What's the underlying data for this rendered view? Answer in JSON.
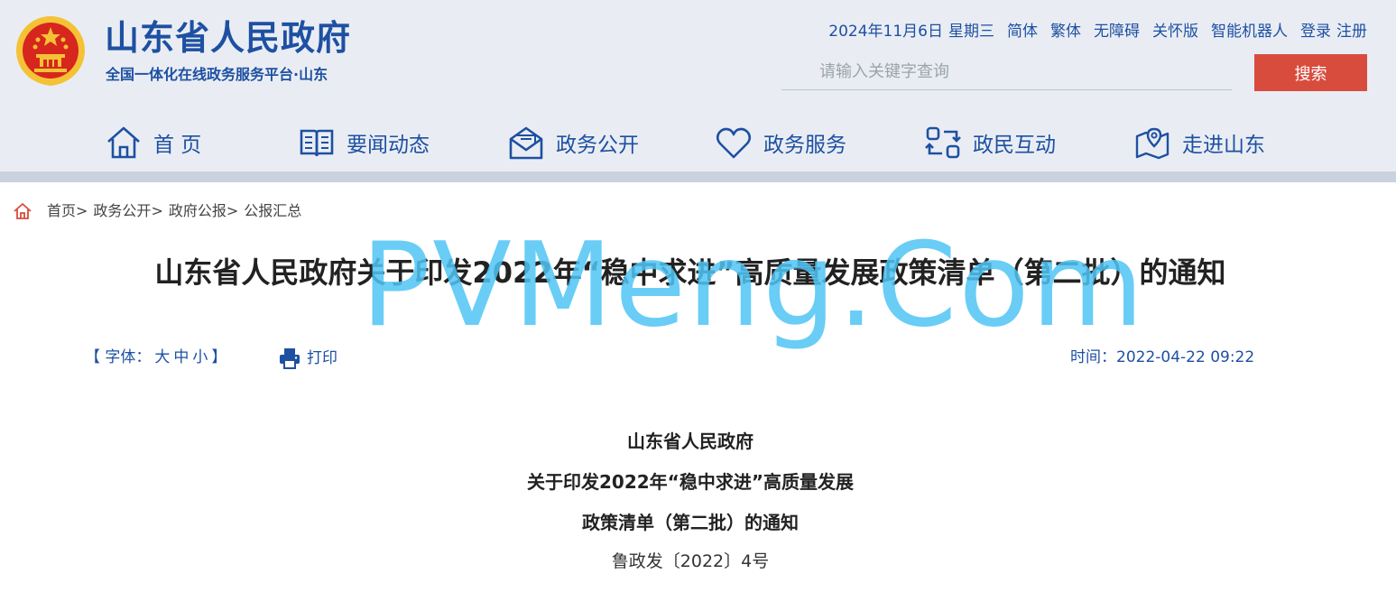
{
  "header": {
    "title": "山东省人民政府",
    "subtitle": "全国一体化在线政务服务平台·山东",
    "date": "2024年11月6日",
    "weekday": "星期三",
    "links": [
      "简体",
      "繁体",
      "无障碍",
      "关怀版",
      "智能机器人",
      "登录",
      "注册"
    ],
    "search_placeholder": "请输入关键字查询",
    "search_button": "搜索"
  },
  "nav": {
    "items": [
      {
        "label": "首 页",
        "icon": "home-icon"
      },
      {
        "label": "要闻动态",
        "icon": "news-book-icon"
      },
      {
        "label": "政务公开",
        "icon": "mail-open-icon"
      },
      {
        "label": "政务服务",
        "icon": "heart-icon"
      },
      {
        "label": "政民互动",
        "icon": "interaction-arrows-icon"
      },
      {
        "label": "走进山东",
        "icon": "map-pin-icon"
      }
    ]
  },
  "breadcrumb": {
    "items": [
      "首页",
      "政务公开",
      "政府公报",
      "公报汇总"
    ],
    "separator": ">"
  },
  "article": {
    "title": "山东省人民政府关于印发2022年“稳中求进”高质量发展政策清单（第二批）的通知",
    "font_ctrl_open": "【 字体：",
    "font_sizes": [
      "大",
      "中",
      "小"
    ],
    "font_ctrl_close": "】",
    "print_label": "打印",
    "time_label": "时间：",
    "time_value": "2022-04-22 09:22",
    "body_lines": [
      "山东省人民政府",
      "关于印发2022年“稳中求进”高质量发展",
      "政策清单（第二批）的通知",
      "鲁政发〔2022〕4号"
    ]
  },
  "watermark": "PVMeng.Com",
  "colors": {
    "brand_blue": "#1e50a2",
    "header_bg": "#e9edf3",
    "search_button": "#d84c3e",
    "watermark": "#4fc5f5",
    "emblem_red": "#d7261d",
    "emblem_gold": "#f5c236"
  }
}
